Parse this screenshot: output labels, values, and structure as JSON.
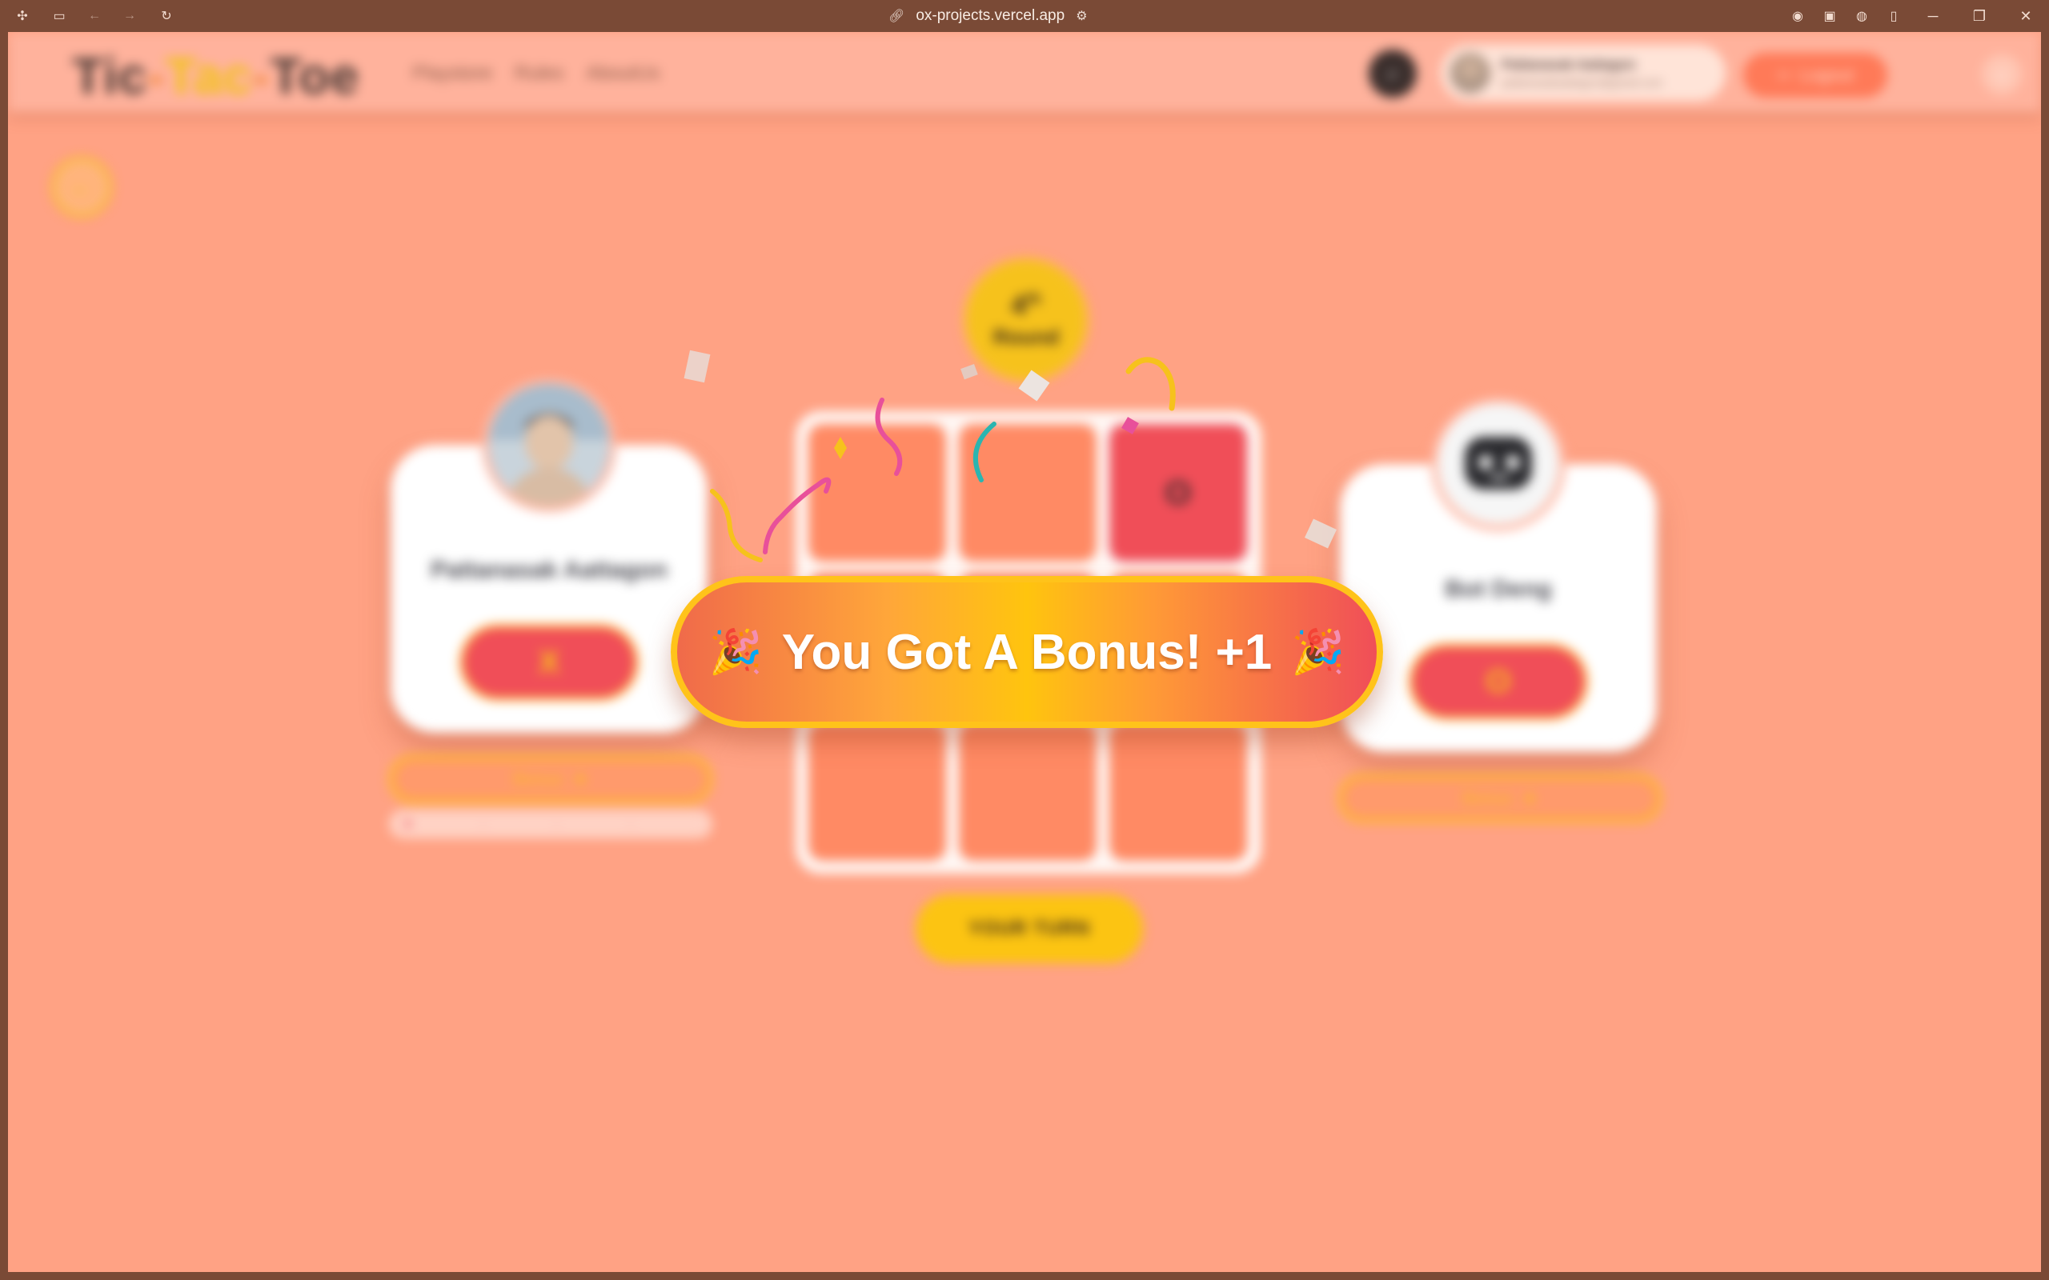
{
  "browser": {
    "url": "ox-projects.vercel.app"
  },
  "app": {
    "logo": {
      "part1": "Tic",
      "dash1": "-",
      "part2": "Tac",
      "dash2": "-",
      "part3": "Toe"
    },
    "nav": [
      "Playstore",
      "Rules",
      "AboutUs"
    ],
    "user": {
      "name": "Pattanasak Aattagon",
      "email": "pattanasakaattagon@gmail.com"
    },
    "logout_label": "Logout"
  },
  "game": {
    "round": {
      "number": "4",
      "suffix": "th",
      "label": "Round"
    },
    "player": {
      "name": "Pattanasak Aattagon",
      "mark": "X",
      "bonus_label": "Bonus",
      "bonus_icon": "star-icon"
    },
    "bot": {
      "name": "Bot Deng",
      "mark": "O",
      "bonus_label": "Bonus",
      "bonus_icon": "star-icon"
    },
    "board": [
      "",
      "",
      "O",
      "",
      "",
      "",
      "",
      "",
      ""
    ],
    "turn_label": "YOUR TURN",
    "lives": [
      "♥",
      "·",
      "·",
      "·",
      "·"
    ]
  },
  "banner": {
    "message": "You Got A Bonus! +1",
    "emoji_left": "🎉",
    "emoji_right": "🎉"
  },
  "colors": {
    "background": "#ffa284",
    "accent_yellow": "#f6c21c",
    "mark_red": "#f04e58",
    "cell_orange": "#ff8a64"
  }
}
